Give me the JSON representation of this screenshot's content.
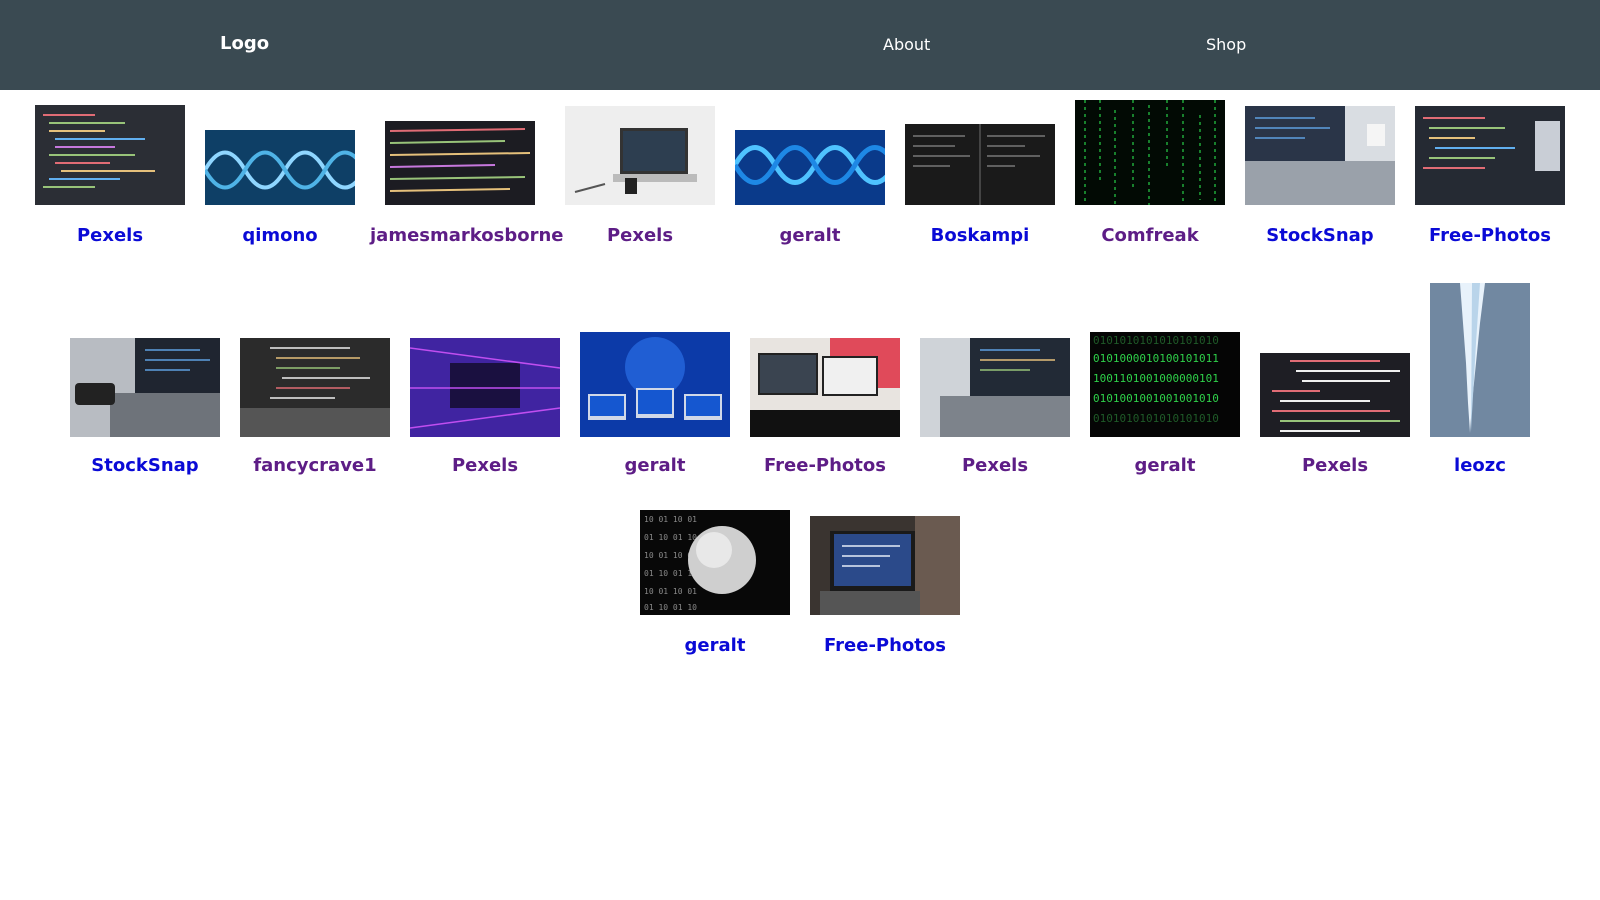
{
  "nav": {
    "logo": "Logo",
    "links": [
      "About",
      "Shop"
    ]
  },
  "colors": {
    "navbar_bg": "#3a4a52",
    "link_unvisited": "#0a0ad6",
    "link_visited": "#5d1d86"
  },
  "gallery": {
    "rows": [
      [
        {
          "author": "Pexels",
          "visited": false,
          "image": "code-screen-image"
        },
        {
          "author": "qimono",
          "visited": false,
          "image": "dna-helix-image"
        },
        {
          "author": "jamesmarkosborne",
          "visited": true,
          "image": "code-closeup-image"
        },
        {
          "author": "Pexels",
          "visited": true,
          "image": "laptop-desk-image"
        },
        {
          "author": "geralt",
          "visited": true,
          "image": "dna-blue-image"
        },
        {
          "author": "Boskampi",
          "visited": false,
          "image": "code-dark-image"
        },
        {
          "author": "Comfreak",
          "visited": true,
          "image": "matrix-rain-image"
        },
        {
          "author": "StockSnap",
          "visited": false,
          "image": "laptop-coffee-image"
        },
        {
          "author": "Free-Photos",
          "visited": false,
          "image": "code-monitor-image"
        }
      ],
      [
        {
          "author": "StockSnap",
          "visited": false,
          "image": "laptop-phone-image"
        },
        {
          "author": "fancycrave1",
          "visited": true,
          "image": "laptop-code-image"
        },
        {
          "author": "Pexels",
          "visited": true,
          "image": "purple-data-image"
        },
        {
          "author": "geralt",
          "visited": true,
          "image": "monitors-city-image"
        },
        {
          "author": "Free-Photos",
          "visited": true,
          "image": "desk-setup-image"
        },
        {
          "author": "Pexels",
          "visited": true,
          "image": "laptop-side-image"
        },
        {
          "author": "geralt",
          "visited": true,
          "image": "binary-green-image"
        },
        {
          "author": "Pexels",
          "visited": true,
          "image": "code-colorful-image"
        },
        {
          "author": "leozc",
          "visited": false,
          "image": "icicle-image"
        }
      ],
      [
        {
          "author": "geralt",
          "visited": false,
          "image": "binary-globe-image"
        },
        {
          "author": "Free-Photos",
          "visited": false,
          "image": "person-laptop-image"
        }
      ]
    ]
  }
}
